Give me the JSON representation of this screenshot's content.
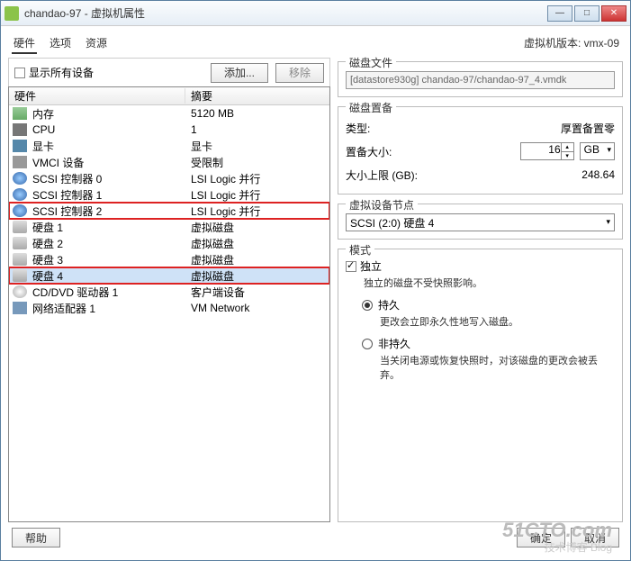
{
  "title": "chandao-97 - 虚拟机属性",
  "vm_version": "虚拟机版本: vmx-09",
  "tabs": {
    "t0": "硬件",
    "t1": "选项",
    "t2": "资源"
  },
  "leftbar": {
    "show_all": "显示所有设备",
    "add": "添加...",
    "remove": "移除"
  },
  "hw_headers": {
    "c1": "硬件",
    "c2": "摘要"
  },
  "hw": [
    {
      "name": "内存",
      "summary": "5120 MB",
      "ic": "mem"
    },
    {
      "name": "CPU",
      "summary": "1",
      "ic": "cpu"
    },
    {
      "name": "显卡",
      "summary": "显卡",
      "ic": "vid"
    },
    {
      "name": "VMCI 设备",
      "summary": "受限制",
      "ic": "vmci"
    },
    {
      "name": "SCSI 控制器 0",
      "summary": "LSI Logic 并行",
      "ic": "scsi"
    },
    {
      "name": "SCSI 控制器 1",
      "summary": "LSI Logic 并行",
      "ic": "scsi"
    },
    {
      "name": "SCSI 控制器 2",
      "summary": "LSI Logic 并行",
      "ic": "scsi"
    },
    {
      "name": "硬盘 1",
      "summary": "虚拟磁盘",
      "ic": "disk"
    },
    {
      "name": "硬盘 2",
      "summary": "虚拟磁盘",
      "ic": "disk"
    },
    {
      "name": "硬盘 3",
      "summary": "虚拟磁盘",
      "ic": "disk"
    },
    {
      "name": "硬盘 4",
      "summary": "虚拟磁盘",
      "ic": "disk"
    },
    {
      "name": "CD/DVD 驱动器 1",
      "summary": "客户端设备",
      "ic": "cd"
    },
    {
      "name": "网络适配器 1",
      "summary": "VM Network",
      "ic": "net"
    }
  ],
  "disk_file": {
    "group": "磁盘文件",
    "path": "[datastore930g] chandao-97/chandao-97_4.vmdk"
  },
  "provision": {
    "group": "磁盘置备",
    "type_label": "类型:",
    "type_value": "厚置备置零",
    "size_label": "置备大小:",
    "size_value": "16",
    "size_unit": "GB",
    "max_label": "大小上限 (GB):",
    "max_value": "248.64"
  },
  "node": {
    "group": "虚拟设备节点",
    "value": "SCSI (2:0) 硬盘 4"
  },
  "mode": {
    "group": "模式",
    "indep": "独立",
    "indep_desc": "独立的磁盘不受快照影响。",
    "persist": "持久",
    "persist_desc": "更改会立即永久性地写入磁盘。",
    "nonpersist": "非持久",
    "nonpersist_desc": "当关闭电源或恢复快照时，对该磁盘的更改会被丢弃。"
  },
  "buttons": {
    "help": "帮助",
    "ok": "确定",
    "cancel": "取消"
  },
  "watermark": "51CTO.com",
  "watermark2": "技术博客 Blog"
}
